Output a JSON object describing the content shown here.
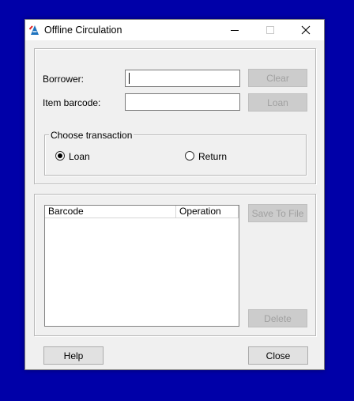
{
  "window": {
    "title": "Offline Circulation",
    "icon": "app-a-logo-icon",
    "background": "#0000a8"
  },
  "form": {
    "borrower_label": "Borrower:",
    "borrower_value": "",
    "item_barcode_label": "Item barcode:",
    "item_barcode_value": "",
    "clear_label": "Clear",
    "loan_button_label": "Loan"
  },
  "transaction": {
    "legend": "Choose transaction",
    "options": [
      {
        "label": "Loan",
        "selected": true
      },
      {
        "label": "Return",
        "selected": false
      }
    ]
  },
  "list": {
    "columns": [
      "Barcode",
      "Operation"
    ],
    "rows": []
  },
  "actions": {
    "save_to_file_label": "Save To File",
    "delete_label": "Delete",
    "help_label": "Help",
    "close_label": "Close"
  }
}
